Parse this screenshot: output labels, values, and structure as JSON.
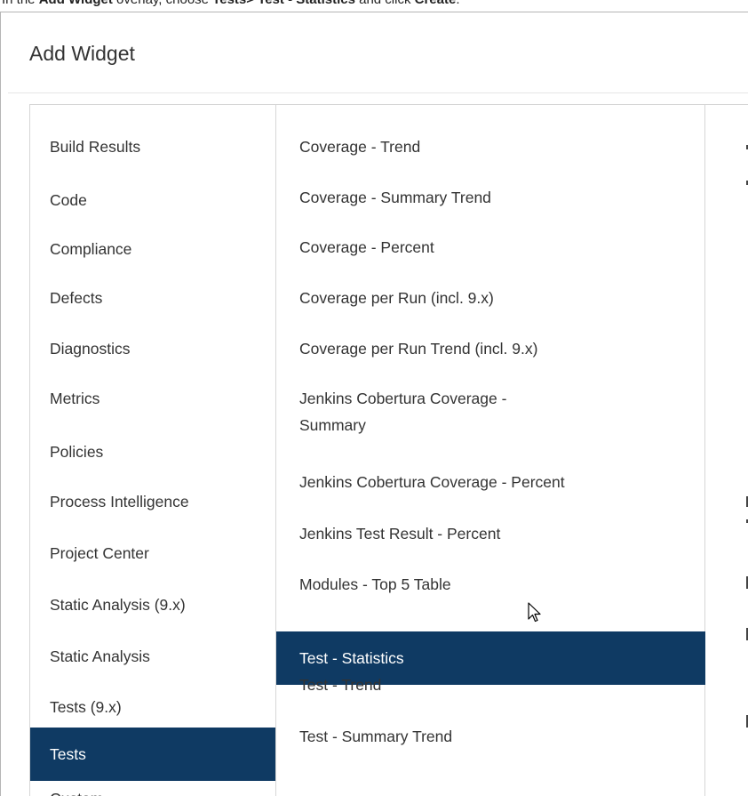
{
  "instruction": {
    "prefix": "In the ",
    "overlay_name": "Add Widget",
    "middle": " overlay, choose ",
    "path": "Tests> Test - Statistics",
    "suffix_mid": " and click ",
    "action": "Create",
    "end": "."
  },
  "dialog": {
    "title": "Add Widget"
  },
  "categories": [
    {
      "label": "Build Results"
    },
    {
      "label": "Code"
    },
    {
      "label": "Compliance"
    },
    {
      "label": "Defects"
    },
    {
      "label": "Diagnostics"
    },
    {
      "label": "Metrics"
    },
    {
      "label": "Policies"
    },
    {
      "label": "Process Intelligence"
    },
    {
      "label": "Project Center"
    },
    {
      "label": "Static Analysis (9.x)"
    },
    {
      "label": "Static Analysis"
    },
    {
      "label": "Tests (9.x)"
    },
    {
      "label": "Tests",
      "selected": true
    },
    {
      "label": "Custom"
    }
  ],
  "widgets": [
    {
      "label": "Coverage - Trend"
    },
    {
      "label": "Coverage - Summary Trend"
    },
    {
      "label": "Coverage - Percent"
    },
    {
      "label": "Coverage per Run (incl. 9.x)"
    },
    {
      "label": "Coverage per Run Trend (incl. 9.x)"
    },
    {
      "label": "Jenkins Cobertura Coverage -",
      "label2": "Summary"
    },
    {
      "label": "Jenkins Cobertura Coverage - Percent"
    },
    {
      "label": "Jenkins Test Result - Percent"
    },
    {
      "label": "Modules - Top 5 Table"
    },
    {
      "label": "Test - Statistics",
      "selected": true
    },
    {
      "label": "Test - Trend"
    },
    {
      "label": "Test - Summary Trend"
    }
  ],
  "colors": {
    "selected_bg": "#0f3a63",
    "selected_text": "#ffffff",
    "text": "#333333",
    "border": "#d6d6d6"
  },
  "cursor": {
    "icon": "mouse-pointer-icon"
  }
}
